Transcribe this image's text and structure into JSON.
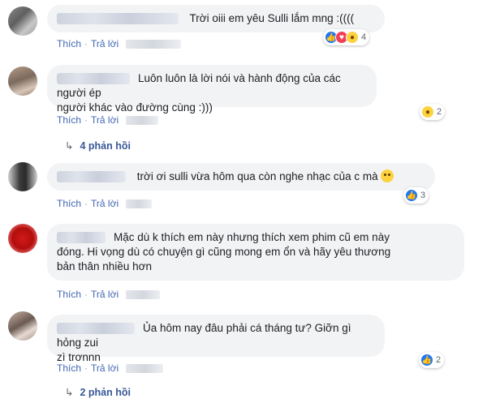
{
  "labels": {
    "like": "Thích",
    "reply": "Trả lời"
  },
  "comments": [
    {
      "text": "Trời oiii em yêu Sulli lắm mng :((((",
      "reaction_count": "4"
    },
    {
      "text_line1": "Luôn luôn là lời nói và hành động của các người ép",
      "text_line2": "người khác vào đường cùng :)))",
      "reaction_count": "2",
      "replies": "4 phản hồi"
    },
    {
      "text": "trời ơi sulli vừa hôm qua còn nghe nhạc của c mà",
      "reaction_count": "3"
    },
    {
      "text_line1": "Mặc dù k thích em này nhưng thích xem phim cũ em này",
      "text_line2": "đóng. Hi vọng dù có chuyện gì cũng mong em ổn và hãy yêu thương",
      "text_line3": "bản thân nhiều hơn"
    },
    {
      "text_line1": "Ủa hôm nay đâu phải cá tháng tư? Giỡn gì hỏng zui",
      "text_line2": "zì trơnnn",
      "reaction_count": "2",
      "replies": "2 phản hồi"
    }
  ],
  "icons": {
    "like": "like-icon",
    "love": "love-icon",
    "sad": "sad-icon",
    "reply_arrow": "reply-arrow-icon"
  },
  "colors": {
    "link": "#4267b2",
    "bubble": "#f2f3f5",
    "like": "#2078f4",
    "love": "#f33e58",
    "sad": "#fcd23f"
  }
}
